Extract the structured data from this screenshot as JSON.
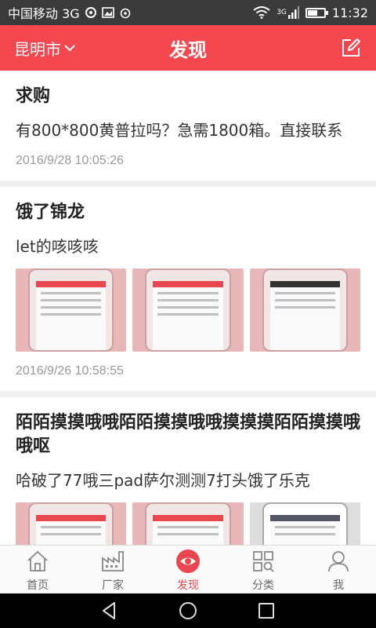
{
  "status_bar": {
    "carrier": "中国移动 3G",
    "time": "11:32",
    "network_label": "3G",
    "battery_level": 0.55
  },
  "header": {
    "city": "昆明市",
    "title": "发现",
    "brand_color": "#f4474f"
  },
  "posts": [
    {
      "title": "求购",
      "body": "有800*800黄普拉吗？急需1800箱。直接联系",
      "time": "2016/9/28 10:05:26",
      "has_images": false
    },
    {
      "title": "饿了锦龙",
      "body": "let的咳咳咳",
      "time": "2016/9/26 10:58:55",
      "has_images": true,
      "image_count": 3
    },
    {
      "title": "陌陌摸摸哦哦陌陌摸摸哦哦摸摸摸陌陌摸摸哦哦呕",
      "body": "哈破了77哦三pad萨尔测测7打头饿了乐克",
      "has_images": true,
      "image_count": 3
    }
  ],
  "tabs": [
    {
      "label": "首页",
      "icon": "home-icon",
      "active": false
    },
    {
      "label": "厂家",
      "icon": "factory-icon",
      "active": false
    },
    {
      "label": "发现",
      "icon": "eye-icon",
      "active": true
    },
    {
      "label": "分类",
      "icon": "category-icon",
      "active": false
    },
    {
      "label": "我",
      "icon": "user-icon",
      "active": false
    }
  ],
  "accent_color": "#e8474f"
}
